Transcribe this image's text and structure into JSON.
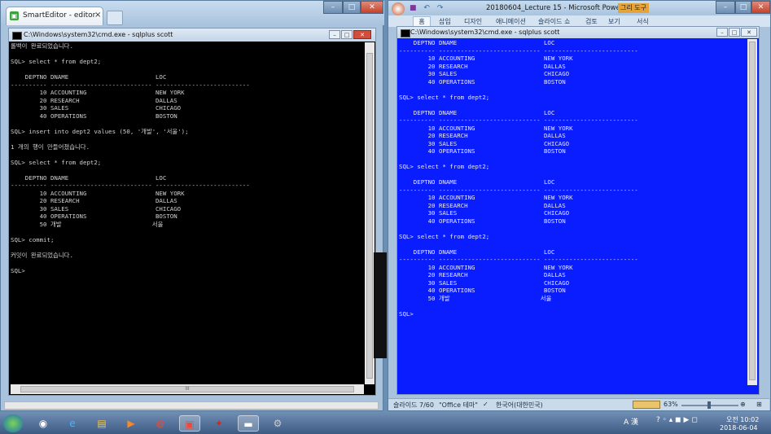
{
  "left_window": {
    "tab_title": "SmartEditor - editor",
    "tab_close": "×",
    "cmd_title": "C:\\Windows\\system32\\cmd.exe - sqlplus  scott",
    "cmd_lines": [
      "롤백이 완료되었습니다.",
      "",
      "SQL> select * from dept2;",
      "",
      "    DEPTNO DNAME                        LOC",
      "---------- ---------------------------- --------------------------",
      "        10 ACCOUNTING                   NEW YORK",
      "        20 RESEARCH                     DALLAS",
      "        30 SALES                        CHICAGO",
      "        40 OPERATIONS                   BOSTON",
      "",
      "SQL> insert into dept2 values (50, '개발', '서울');",
      "",
      "1 개의 행이 만들어졌습니다.",
      "",
      "SQL> select * from dept2;",
      "",
      "    DEPTNO DNAME                        LOC",
      "---------- ---------------------------- --------------------------",
      "        10 ACCOUNTING                   NEW YORK",
      "        20 RESEARCH                     DALLAS",
      "        30 SALES                        CHICAGO",
      "        40 OPERATIONS                   BOSTON",
      "        50 개발                         서울",
      "",
      "SQL> commit;",
      "",
      "커밋이 완료되었습니다.",
      "",
      "SQL>"
    ],
    "hscroll_glyph": "III"
  },
  "ppt_window": {
    "title": "20180604_Lecture 15 - Microsoft PowerPoint",
    "tool_label": "그리 도구",
    "ribbon_tabs": [
      "홈",
      "삽입",
      "디자인",
      "애니메이션",
      "슬라이드 쇼",
      "검토",
      "보기",
      "서식"
    ],
    "cmd_title": "C:\\Windows\\system32\\cmd.exe - sqlplus  scott",
    "cmd_lines": [
      "    DEPTNO DNAME                        LOC",
      "---------- ---------------------------- --------------------------",
      "        10 ACCOUNTING                   NEW YORK",
      "        20 RESEARCH                     DALLAS",
      "        30 SALES                        CHICAGO",
      "        40 OPERATIONS                   BOSTON",
      "",
      "SQL> select * from dept2;",
      "",
      "    DEPTNO DNAME                        LOC",
      "---------- ---------------------------- --------------------------",
      "        10 ACCOUNTING                   NEW YORK",
      "        20 RESEARCH                     DALLAS",
      "        30 SALES                        CHICAGO",
      "        40 OPERATIONS                   BOSTON",
      "",
      "SQL> select * from dept2;",
      "",
      "    DEPTNO DNAME                        LOC",
      "---------- ---------------------------- --------------------------",
      "        10 ACCOUNTING                   NEW YORK",
      "        20 RESEARCH                     DALLAS",
      "        30 SALES                        CHICAGO",
      "        40 OPERATIONS                   BOSTON",
      "",
      "SQL> select * from dept2;",
      "",
      "    DEPTNO DNAME                        LOC",
      "---------- ---------------------------- --------------------------",
      "        10 ACCOUNTING                   NEW YORK",
      "        20 RESEARCH                     DALLAS",
      "        30 SALES                        CHICAGO",
      "        40 OPERATIONS                   BOSTON",
      "        50 개발                         서울",
      "",
      "SQL>"
    ],
    "status": {
      "slide": "슬라이드 7/60",
      "theme": "\"Office 테마\"",
      "language": "한국어(대한민국)",
      "zoom": "63%"
    }
  },
  "taskbar": {
    "tray_ime": "A 漢",
    "time": "오전 10:02",
    "date": "2018-06-04"
  },
  "colors": {
    "cmd_left_bg": "#000000",
    "cmd_right_bg": "#0a1dff",
    "taskbar": "#3c5b83"
  }
}
